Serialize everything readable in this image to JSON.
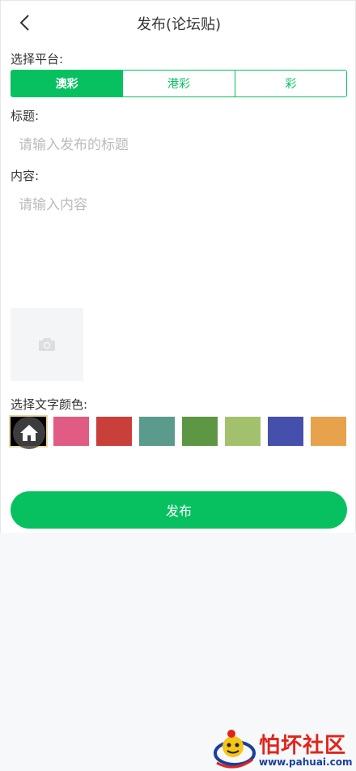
{
  "header": {
    "title": "发布(论坛贴)"
  },
  "platform": {
    "label": "选择平台:",
    "options": [
      "澳彩",
      "港彩",
      "彩"
    ],
    "selected_index": 0
  },
  "title_field": {
    "label": "标题:",
    "placeholder": "请输入发布的标题",
    "value": ""
  },
  "content_field": {
    "label": "内容:",
    "placeholder": "请输入内容",
    "value": ""
  },
  "image_upload": {
    "icon": "camera-icon"
  },
  "text_color": {
    "label": "选择文字颜色:",
    "colors": [
      "#000000",
      "#e05c85",
      "#c9403a",
      "#5b9b8d",
      "#5e9744",
      "#a3c16d",
      "#4550ac",
      "#e9a24c"
    ],
    "selected_index": 0
  },
  "submit": {
    "label": "发布"
  },
  "watermark": {
    "name": "怕坏社区",
    "url": "www.pahuai.com"
  },
  "colors": {
    "accent": "#07c160",
    "page_bg": "#f7f8fa"
  }
}
